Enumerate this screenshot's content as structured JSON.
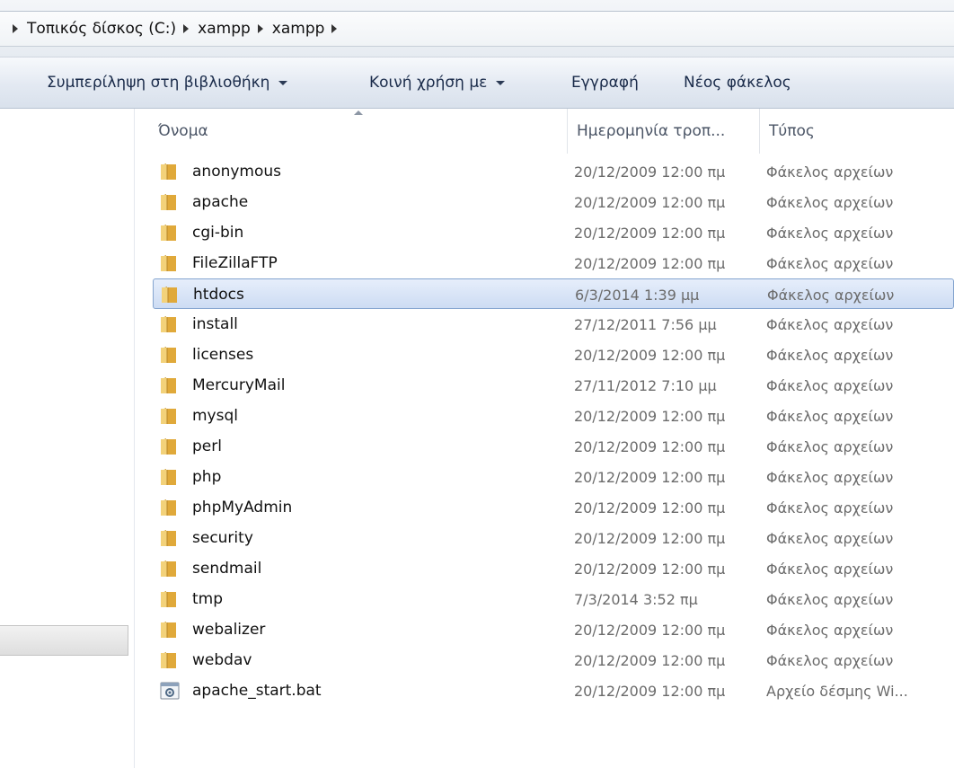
{
  "address": {
    "breadcrumbs": [
      "Τοπικός δίσκος (C:)",
      "xampp",
      "xampp"
    ]
  },
  "toolbar": {
    "include_library": "Συμπερίληψη στη βιβλιοθήκη",
    "share_with": "Κοινή χρήση με",
    "burn": "Εγγραφή",
    "new_folder": "Νέος φάκελος"
  },
  "columns": {
    "name": "Όνομα",
    "date_modified": "Ημερομηνία τροπ...",
    "type": "Τύπος"
  },
  "selected_index": 4,
  "files": [
    {
      "name": "anonymous",
      "date": "20/12/2009 12:00 πμ",
      "type": "Φάκελος αρχείων",
      "icon": "folder-icon"
    },
    {
      "name": "apache",
      "date": "20/12/2009 12:00 πμ",
      "type": "Φάκελος αρχείων",
      "icon": "folder-icon"
    },
    {
      "name": "cgi-bin",
      "date": "20/12/2009 12:00 πμ",
      "type": "Φάκελος αρχείων",
      "icon": "folder-icon"
    },
    {
      "name": "FileZillaFTP",
      "date": "20/12/2009 12:00 πμ",
      "type": "Φάκελος αρχείων",
      "icon": "folder-icon"
    },
    {
      "name": "htdocs",
      "date": "6/3/2014 1:39 μμ",
      "type": "Φάκελος αρχείων",
      "icon": "folder-icon"
    },
    {
      "name": "install",
      "date": "27/12/2011 7:56 μμ",
      "type": "Φάκελος αρχείων",
      "icon": "folder-icon"
    },
    {
      "name": "licenses",
      "date": "20/12/2009 12:00 πμ",
      "type": "Φάκελος αρχείων",
      "icon": "folder-icon"
    },
    {
      "name": "MercuryMail",
      "date": "27/11/2012 7:10 μμ",
      "type": "Φάκελος αρχείων",
      "icon": "folder-icon"
    },
    {
      "name": "mysql",
      "date": "20/12/2009 12:00 πμ",
      "type": "Φάκελος αρχείων",
      "icon": "folder-icon"
    },
    {
      "name": "perl",
      "date": "20/12/2009 12:00 πμ",
      "type": "Φάκελος αρχείων",
      "icon": "folder-icon"
    },
    {
      "name": "php",
      "date": "20/12/2009 12:00 πμ",
      "type": "Φάκελος αρχείων",
      "icon": "folder-icon"
    },
    {
      "name": "phpMyAdmin",
      "date": "20/12/2009 12:00 πμ",
      "type": "Φάκελος αρχείων",
      "icon": "folder-icon"
    },
    {
      "name": "security",
      "date": "20/12/2009 12:00 πμ",
      "type": "Φάκελος αρχείων",
      "icon": "folder-icon"
    },
    {
      "name": "sendmail",
      "date": "20/12/2009 12:00 πμ",
      "type": "Φάκελος αρχείων",
      "icon": "folder-icon"
    },
    {
      "name": "tmp",
      "date": "7/3/2014 3:52 πμ",
      "type": "Φάκελος αρχείων",
      "icon": "folder-icon"
    },
    {
      "name": "webalizer",
      "date": "20/12/2009 12:00 πμ",
      "type": "Φάκελος αρχείων",
      "icon": "folder-icon"
    },
    {
      "name": "webdav",
      "date": "20/12/2009 12:00 πμ",
      "type": "Φάκελος αρχείων",
      "icon": "folder-icon"
    },
    {
      "name": "apache_start.bat",
      "date": "20/12/2009 12:00 πμ",
      "type": "Αρχείο δέσμης Wi...",
      "icon": "batch-file-icon"
    }
  ]
}
